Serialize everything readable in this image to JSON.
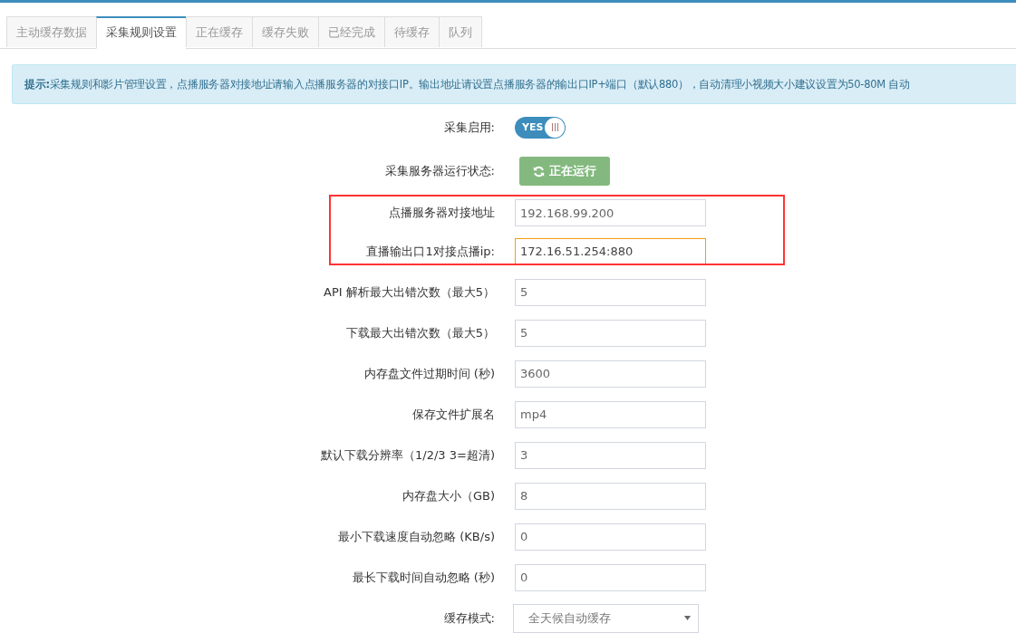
{
  "tabs": [
    {
      "label": "主动缓存数据",
      "selected": false
    },
    {
      "label": "采集规则设置",
      "selected": true
    },
    {
      "label": "正在缓存",
      "selected": false
    },
    {
      "label": "缓存失败",
      "selected": false
    },
    {
      "label": "已经完成",
      "selected": false
    },
    {
      "label": "待缓存",
      "selected": false
    },
    {
      "label": "队列",
      "selected": false
    }
  ],
  "alert": {
    "title": "提示:",
    "text": "采集规则和影片管理设置，点播服务器对接地址请输入点播服务器的对接口IP。输出地址请设置点播服务器的输出口IP+端口（默认880），自动清理小视频大小建议设置为50-80M 自动"
  },
  "fields": [
    {
      "kind": "toggle",
      "label": "采集启用:",
      "on": true,
      "text": "YES",
      "highlighted": false
    },
    {
      "kind": "button",
      "label": "采集服务器运行状态:",
      "text": "正在运行",
      "highlighted": false
    },
    {
      "kind": "input",
      "label": "点播服务器对接地址",
      "value": "192.168.99.200",
      "focused": false,
      "highlighted": true
    },
    {
      "kind": "input",
      "label": "直播输出口1对接点播ip:",
      "value": "172.16.51.254:880",
      "focused": true,
      "highlighted": true
    },
    {
      "kind": "input",
      "label": "API 解析最大出错次数（最大5）",
      "value": "5",
      "focused": false,
      "highlighted": false
    },
    {
      "kind": "input",
      "label": "下载最大出错次数（最大5）",
      "value": "5",
      "focused": false,
      "highlighted": false
    },
    {
      "kind": "input",
      "label": "内存盘文件过期时间 (秒)",
      "value": "3600",
      "focused": false,
      "highlighted": false
    },
    {
      "kind": "input",
      "label": "保存文件扩展名",
      "value": "mp4",
      "focused": false,
      "highlighted": false
    },
    {
      "kind": "input",
      "label": "默认下载分辨率（1/2/3 3=超清)",
      "value": "3",
      "focused": false,
      "highlighted": false
    },
    {
      "kind": "input",
      "label": "内存盘大小（GB)",
      "value": "8",
      "focused": false,
      "highlighted": false
    },
    {
      "kind": "input",
      "label": "最小下载速度自动忽略 (KB/s)",
      "value": "0",
      "focused": false,
      "highlighted": false
    },
    {
      "kind": "input",
      "label": "最长下载时间自动忽略 (秒)",
      "value": "0",
      "focused": false,
      "highlighted": false
    },
    {
      "kind": "select",
      "label": "缓存模式:",
      "value": "全天候自动缓存",
      "highlighted": false
    }
  ]
}
